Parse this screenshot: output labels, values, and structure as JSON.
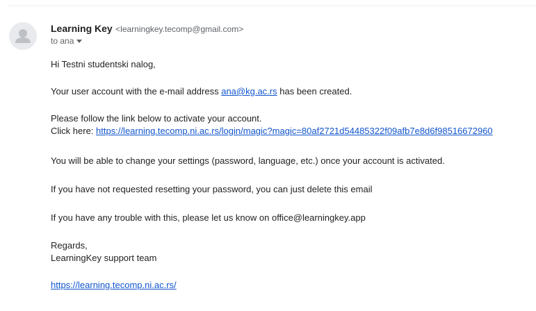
{
  "message": {
    "sender_name": "Learning Key",
    "sender_email": "<learningkey.tecomp@gmail.com>",
    "recipient_label": "to ana",
    "greeting": "Hi Testni studentski nalog,",
    "account_line": {
      "before": "Your user account with the e-mail address ",
      "email_link": "ana@kg.ac.rs",
      "after": " has been created."
    },
    "activate_instruction": "Please follow the link below to activate your account.",
    "click_here_label": "Click here: ",
    "activation_link": "https://learning.tecomp.ni.ac.rs/login/magic?magic=80af2721d54485322f09afb7e8d6f98516672960",
    "settings_note": "You will be able to change your settings (password, language, etc.) once your account is activated.",
    "not_requested_note": "If you have not requested resetting your password, you can just delete this email",
    "trouble_note": "If you have any trouble with this, please let us know on office@learningkey.app",
    "regards": "Regards,",
    "signature": "LearningKey support team",
    "footer_link": "https://learning.tecomp.ni.ac.rs/"
  },
  "icons": {
    "avatar": "default-person-icon",
    "recipient_details": "caret-down-icon"
  },
  "colors": {
    "link": "#1155cc",
    "avatar_bg": "#e8eaed",
    "avatar_fg": "#bdc1c6",
    "secondary_text": "#5f6368"
  }
}
